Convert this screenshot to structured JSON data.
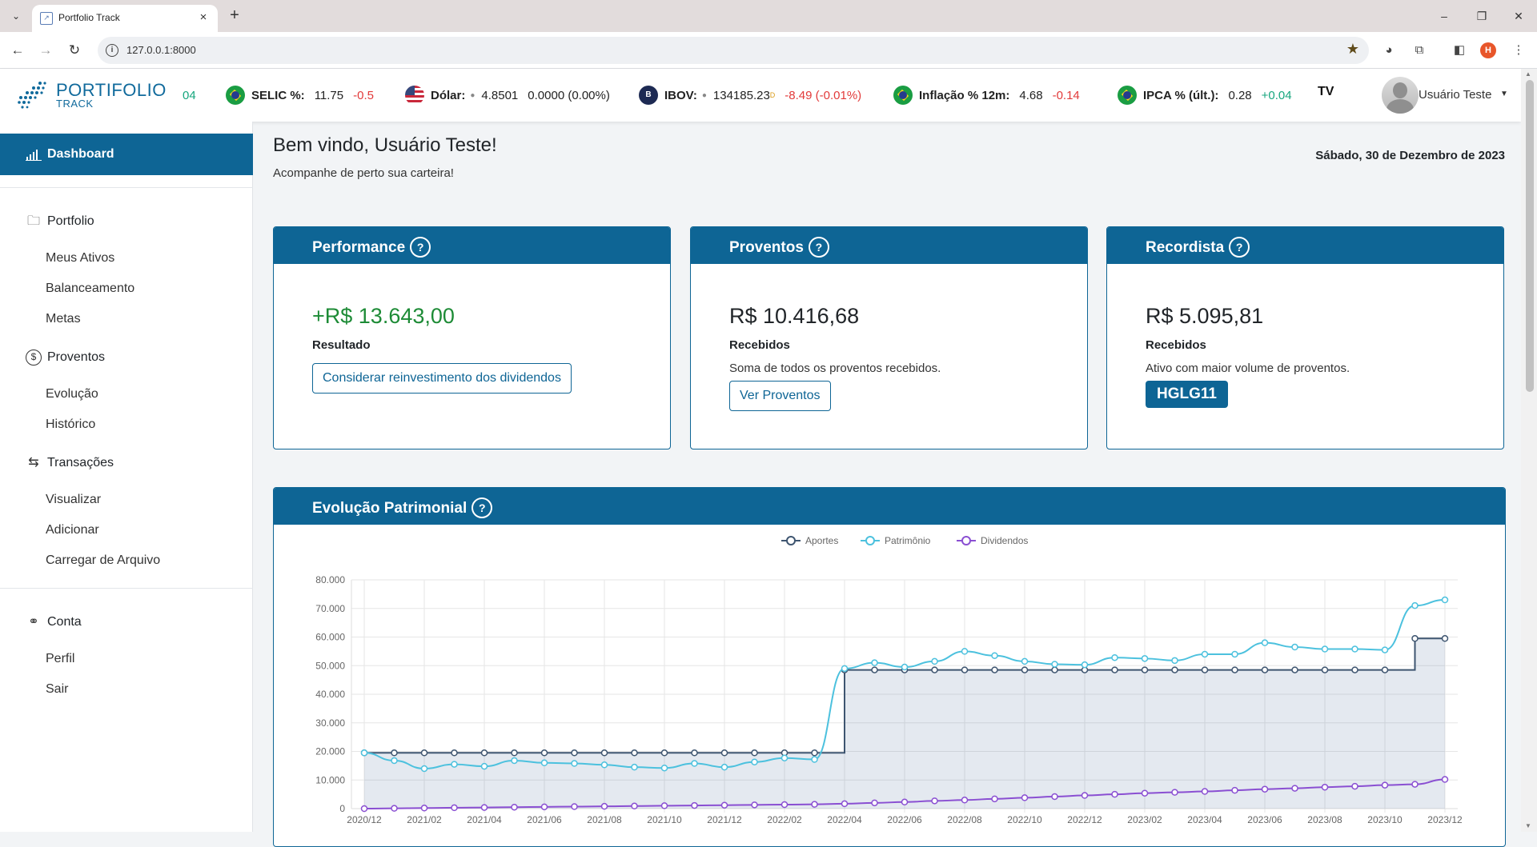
{
  "browser": {
    "tab_title": "Portfolio Track",
    "url": "127.0.0.1:8000",
    "profile_initial": "H"
  },
  "header": {
    "logo_word1": "PORTIFOLIO",
    "logo_word2": "TRACK",
    "ticker_lead": "04",
    "tickers": [
      {
        "name": "SELIC %:",
        "value": "11.75",
        "change": "-0.5",
        "trend": "neg",
        "flag": "br"
      },
      {
        "name": "Dólar:",
        "value": "4.8501",
        "change": "0.0000 (0.00%)",
        "trend": "flat",
        "flag": "us"
      },
      {
        "name": "IBOV:",
        "value": "134185.23",
        "sup": "D",
        "change": "-8.49 (-0.01%)",
        "trend": "neg",
        "flag": "b3"
      },
      {
        "name": "Inflação % 12m:",
        "value": "4.68",
        "change": "-0.14",
        "trend": "neg",
        "flag": "br"
      },
      {
        "name": "IPCA % (últ.):",
        "value": "0.28",
        "change": "+0.04",
        "trend": "pos",
        "flag": "br"
      }
    ],
    "tradingview_logo": "TV",
    "user_name": "Usuário Teste"
  },
  "sidebar": {
    "dashboard_label": "Dashboard",
    "sections": [
      {
        "label": "Portfolio",
        "icon": "folder-icon",
        "items": [
          "Meus Ativos",
          "Balanceamento",
          "Metas"
        ]
      },
      {
        "label": "Proventos",
        "icon": "dollar-circle-icon",
        "items": [
          "Evolução",
          "Histórico"
        ]
      },
      {
        "label": "Transações",
        "icon": "swap-arrows-icon",
        "items": [
          "Visualizar",
          "Adicionar",
          "Carregar de Arquivo"
        ]
      },
      {
        "label": "Conta",
        "icon": "user-gear-icon",
        "items": [
          "Perfil",
          "Sair"
        ]
      }
    ]
  },
  "main": {
    "welcome": "Bem vindo, Usuário Teste!",
    "welcome_sub": "Acompanhe de perto sua carteira!",
    "date": "Sábado, 30 de Dezembro de 2023",
    "cards": {
      "performance": {
        "title": "Performance",
        "value": "+R$ 13.643,00",
        "label": "Resultado",
        "button": "Considerar reinvestimento dos dividendos"
      },
      "proventos": {
        "title": "Proventos",
        "value": "R$ 10.416,68",
        "label": "Recebidos",
        "desc": "Soma de todos os proventos recebidos.",
        "button": "Ver Proventos"
      },
      "recordista": {
        "title": "Recordista",
        "value": "R$ 5.095,81",
        "label": "Recebidos",
        "desc": "Ativo com maior volume de proventos.",
        "badge": "HGLG11"
      }
    },
    "chart_title": "Evolução Patrimonial"
  },
  "colors": {
    "brand": "#0e6595",
    "positive": "#1d8b36",
    "negative": "#e23a3a",
    "aportes": "#3e5570",
    "patrimonio": "#4cc1de",
    "dividendos": "#8a4fd2"
  },
  "chart_data": {
    "type": "line",
    "title": "",
    "legend": "top-center",
    "grid": true,
    "ylim": [
      0,
      80000
    ],
    "yticks": [
      "0",
      "10.000",
      "20.000",
      "30.000",
      "40.000",
      "50.000",
      "60.000",
      "70.000",
      "80.000"
    ],
    "x": [
      "2020/12",
      "2021/01",
      "2021/02",
      "2021/03",
      "2021/04",
      "2021/05",
      "2021/06",
      "2021/07",
      "2021/08",
      "2021/09",
      "2021/10",
      "2021/11",
      "2021/12",
      "2022/01",
      "2022/02",
      "2022/03",
      "2022/04",
      "2022/05",
      "2022/06",
      "2022/07",
      "2022/08",
      "2022/09",
      "2022/10",
      "2022/11",
      "2022/12",
      "2023/01",
      "2023/02",
      "2023/03",
      "2023/04",
      "2023/05",
      "2023/06",
      "2023/07",
      "2023/08",
      "2023/09",
      "2023/10",
      "2023/11",
      "2023/12"
    ],
    "x_tick_labels": [
      "2020/12",
      "2021/02",
      "2021/04",
      "2021/06",
      "2021/08",
      "2021/10",
      "2021/12",
      "2022/02",
      "2022/04",
      "2022/06",
      "2022/08",
      "2022/10",
      "2022/12",
      "2023/02",
      "2023/04",
      "2023/06",
      "2023/08",
      "2023/10",
      "2023/12"
    ],
    "series": [
      {
        "name": "Aportes",
        "step": true,
        "fill": true,
        "values": [
          19500,
          19500,
          19500,
          19500,
          19500,
          19500,
          19500,
          19500,
          19500,
          19500,
          19500,
          19500,
          19500,
          19500,
          19500,
          19500,
          48500,
          48500,
          48500,
          48500,
          48500,
          48500,
          48500,
          48500,
          48500,
          48500,
          48500,
          48500,
          48500,
          48500,
          48500,
          48500,
          48500,
          48500,
          48500,
          59500,
          59500
        ]
      },
      {
        "name": "Patrimônio",
        "values": [
          19500,
          16800,
          14000,
          15500,
          14800,
          16800,
          16000,
          15800,
          15300,
          14500,
          14200,
          15800,
          14500,
          16300,
          17700,
          17200,
          49000,
          51000,
          49500,
          51500,
          55000,
          53500,
          51500,
          50500,
          50300,
          52800,
          52500,
          51800,
          54000,
          54000,
          58000,
          56500,
          55800,
          55800,
          55500,
          71000,
          73000
        ]
      },
      {
        "name": "Dividendos",
        "values": [
          0,
          100,
          200,
          300,
          400,
          500,
          600,
          700,
          800,
          900,
          1000,
          1100,
          1200,
          1300,
          1400,
          1500,
          1700,
          2000,
          2300,
          2700,
          3000,
          3400,
          3800,
          4200,
          4600,
          5000,
          5400,
          5700,
          6000,
          6400,
          6800,
          7100,
          7500,
          7800,
          8200,
          8500,
          10200
        ]
      }
    ]
  }
}
